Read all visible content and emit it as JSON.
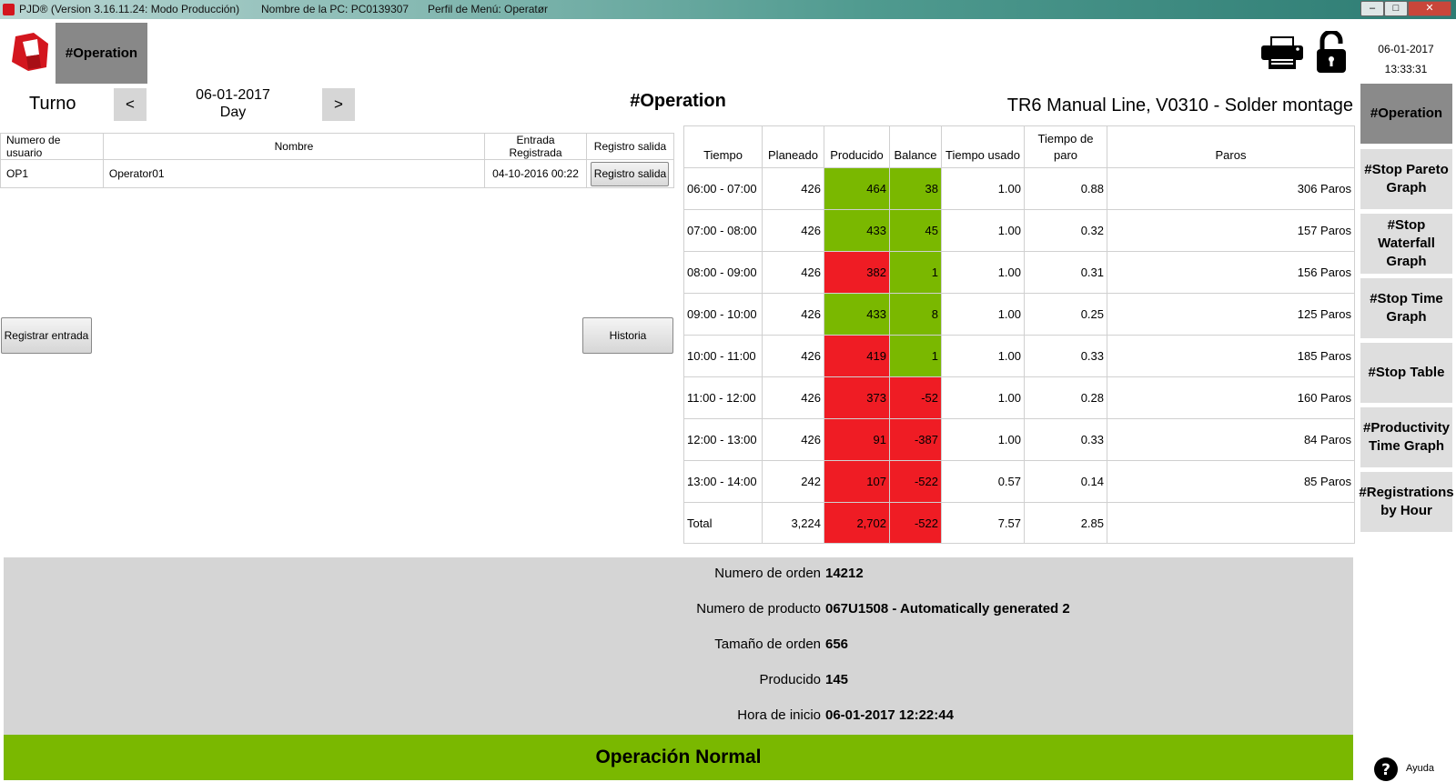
{
  "titlebar": {
    "app_version": "PJD® (Version 3.16.11.24: Modo Producción)",
    "pc_name": "Nombre de la PC: PC0139307",
    "menu_profile": "Perfil de Menú: Operatør",
    "min": "–",
    "max": "□",
    "close": "✕"
  },
  "header": {
    "operation_tile": "#Operation",
    "date": "06-01-2017",
    "time": "13:33:31",
    "icons": [
      "logo-icon",
      "printer-icon",
      "lock-icon"
    ]
  },
  "shift": {
    "label": "Turno",
    "prev": "<",
    "next": ">",
    "date": "06-01-2017",
    "shift_name": "Day"
  },
  "page_title": "#Operation",
  "line_title": "TR6 Manual Line, V0310 - Solder montage",
  "users_table": {
    "headers": [
      "Numero de usuario",
      "Nombre",
      "Entrada Registrada",
      "Registro salida"
    ],
    "rows": [
      {
        "user": "OP1",
        "name": "Operator01",
        "entry": "04-10-2016 00:22",
        "action": "Registro salida"
      }
    ]
  },
  "buttons": {
    "register_entry": "Registrar entrada",
    "history": "Historia"
  },
  "production_table": {
    "headers": [
      "Tiempo",
      "Planeado",
      "Producido",
      "Balance",
      "Tiempo usado",
      "Tiempo de paro",
      "Paros"
    ],
    "rows": [
      {
        "time": "06:00 - 07:00",
        "planned": "426",
        "produced": "464",
        "balance": "38",
        "used": "1.00",
        "stop": "0.88",
        "paros": "306 Paros",
        "produced_status": "ok",
        "balance_status": "ok"
      },
      {
        "time": "07:00 - 08:00",
        "planned": "426",
        "produced": "433",
        "balance": "45",
        "used": "1.00",
        "stop": "0.32",
        "paros": "157 Paros",
        "produced_status": "ok",
        "balance_status": "ok"
      },
      {
        "time": "08:00 - 09:00",
        "planned": "426",
        "produced": "382",
        "balance": "1",
        "used": "1.00",
        "stop": "0.31",
        "paros": "156 Paros",
        "produced_status": "bad",
        "balance_status": "ok"
      },
      {
        "time": "09:00 - 10:00",
        "planned": "426",
        "produced": "433",
        "balance": "8",
        "used": "1.00",
        "stop": "0.25",
        "paros": "125 Paros",
        "produced_status": "ok",
        "balance_status": "ok"
      },
      {
        "time": "10:00 - 11:00",
        "planned": "426",
        "produced": "419",
        "balance": "1",
        "used": "1.00",
        "stop": "0.33",
        "paros": "185 Paros",
        "produced_status": "bad",
        "balance_status": "ok"
      },
      {
        "time": "11:00 - 12:00",
        "planned": "426",
        "produced": "373",
        "balance": "-52",
        "used": "1.00",
        "stop": "0.28",
        "paros": "160 Paros",
        "produced_status": "bad",
        "balance_status": "bad"
      },
      {
        "time": "12:00 - 13:00",
        "planned": "426",
        "produced": "91",
        "balance": "-387",
        "used": "1.00",
        "stop": "0.33",
        "paros": "84 Paros",
        "produced_status": "bad",
        "balance_status": "bad"
      },
      {
        "time": "13:00 - 14:00",
        "planned": "242",
        "produced": "107",
        "balance": "-522",
        "used": "0.57",
        "stop": "0.14",
        "paros": "85 Paros",
        "produced_status": "bad",
        "balance_status": "bad"
      }
    ],
    "total": {
      "time": "Total",
      "planned": "3,224",
      "produced": "2,702",
      "balance": "-522",
      "used": "7.57",
      "stop": "2.85",
      "paros": "",
      "produced_status": "bad",
      "balance_status": "bad"
    }
  },
  "order_info": {
    "order_number_label": "Numero de orden",
    "order_number": "14212",
    "product_number_label": "Numero de producto",
    "product_number": "067U1508 - Automatically generated 2",
    "order_size_label": "Tamaño de orden",
    "order_size": "656",
    "produced_label": "Producido",
    "produced": "145",
    "start_time_label": "Hora de inicio",
    "start_time": "06-01-2017 12:22:44"
  },
  "status": {
    "text": "Operación Normal",
    "color": "#7ab800"
  },
  "side_menu": {
    "items": [
      {
        "label": "#Operation",
        "active": true
      },
      {
        "label": "#Stop Pareto Graph",
        "active": false
      },
      {
        "label": "#Stop Waterfall Graph",
        "active": false
      },
      {
        "label": "#Stop Time Graph",
        "active": false
      },
      {
        "label": "#Stop Table",
        "active": false
      },
      {
        "label": "#Productivity Time Graph",
        "active": false
      },
      {
        "label": "#Registrations by Hour",
        "active": false
      }
    ]
  },
  "help": {
    "label": "Ayuda",
    "icon": "question-icon"
  },
  "colors": {
    "ok": "#7ab800",
    "bad": "#ef1c24",
    "active_tile": "#8a8a8a",
    "menu_bg": "#dedede",
    "panel_bg": "#d5d5d5"
  }
}
